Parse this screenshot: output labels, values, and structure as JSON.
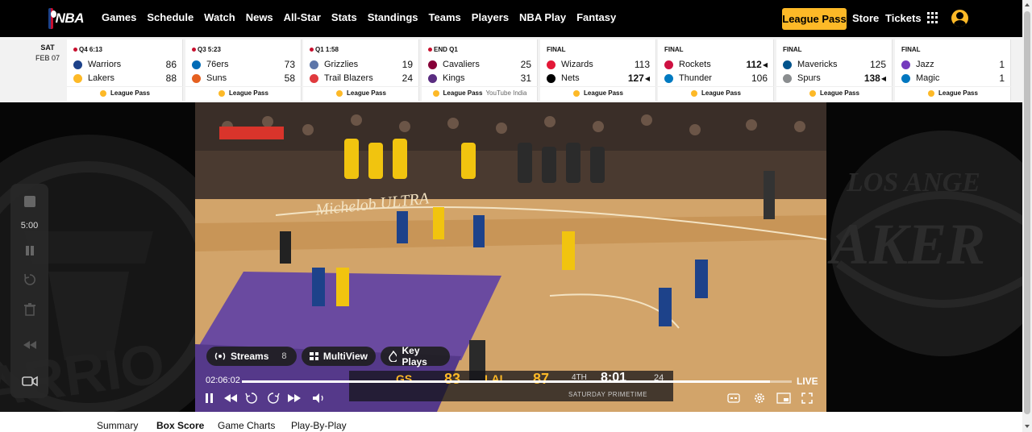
{
  "nav": {
    "logo_text": "NBA",
    "links": [
      "Games",
      "Schedule",
      "Watch",
      "News",
      "All-Star",
      "Stats",
      "Standings",
      "Teams",
      "Players",
      "NBA Play",
      "Fantasy"
    ],
    "league_pass": "League Pass",
    "store": "Store",
    "tickets": "Tickets"
  },
  "scoreboard": {
    "day": "SAT",
    "date": "FEB 07",
    "games": [
      {
        "status": "Q4 6:13",
        "live": true,
        "away": {
          "name": "Warriors",
          "score": "86",
          "color": "#1d428a"
        },
        "home": {
          "name": "Lakers",
          "score": "88",
          "color": "#fdb927"
        },
        "footer": "League Pass",
        "extra": ""
      },
      {
        "status": "Q3 5:23",
        "live": true,
        "away": {
          "name": "76ers",
          "score": "73",
          "color": "#006bb6"
        },
        "home": {
          "name": "Suns",
          "score": "58",
          "color": "#e56020"
        },
        "footer": "League Pass",
        "extra": ""
      },
      {
        "status": "Q1 1:58",
        "live": true,
        "away": {
          "name": "Grizzlies",
          "score": "19",
          "color": "#5d76a9"
        },
        "home": {
          "name": "Trail Blazers",
          "score": "24",
          "color": "#e03a3e"
        },
        "footer": "League Pass",
        "extra": ""
      },
      {
        "status": "END Q1",
        "live": true,
        "away": {
          "name": "Cavaliers",
          "score": "25",
          "color": "#860038"
        },
        "home": {
          "name": "Kings",
          "score": "31",
          "color": "#5a2d81"
        },
        "footer": "League Pass",
        "extra": "YouTube India"
      },
      {
        "status": "FINAL",
        "live": false,
        "away": {
          "name": "Wizards",
          "score": "113",
          "color": "#e31837"
        },
        "home": {
          "name": "Nets",
          "score": "127",
          "color": "#000000"
        },
        "footer": "League Pass",
        "extra": "",
        "winner": "home"
      },
      {
        "status": "FINAL",
        "live": false,
        "away": {
          "name": "Rockets",
          "score": "112",
          "color": "#ce1141"
        },
        "home": {
          "name": "Thunder",
          "score": "106",
          "color": "#007ac1"
        },
        "footer": "League Pass",
        "extra": "",
        "winner": "away"
      },
      {
        "status": "FINAL",
        "live": false,
        "away": {
          "name": "Mavericks",
          "score": "125",
          "color": "#00538c"
        },
        "home": {
          "name": "Spurs",
          "score": "138",
          "color": "#8a8d8f"
        },
        "footer": "League Pass",
        "extra": "",
        "winner": "home"
      },
      {
        "status": "FINAL",
        "live": false,
        "away": {
          "name": "Jazz",
          "score": "1",
          "color": "#753bbd"
        },
        "home": {
          "name": "Magic",
          "score": "1",
          "color": "#0077c0"
        },
        "footer": "League Pass",
        "extra": ""
      }
    ]
  },
  "player": {
    "side_time": "5:00",
    "streams_label": "Streams",
    "streams_count": "8",
    "multiview_label": "MultiView",
    "keyplays_label": "Key Plays",
    "elapsed": "02:06:02",
    "live_label": "LIVE",
    "progress": 0.96,
    "bug": {
      "away": "GS",
      "away_score": "83",
      "home": "LAL",
      "home_score": "87",
      "period": "4TH",
      "clock": "8:01",
      "shot": "24",
      "banner": "SATURDAY PRIMETIME"
    }
  },
  "tabs": [
    "Summary",
    "Box Score",
    "Game Charts",
    "Play-By-Play"
  ],
  "active_tab": "Box Score",
  "colors": {
    "accent": "#fdb927",
    "live": "#c8102e"
  }
}
